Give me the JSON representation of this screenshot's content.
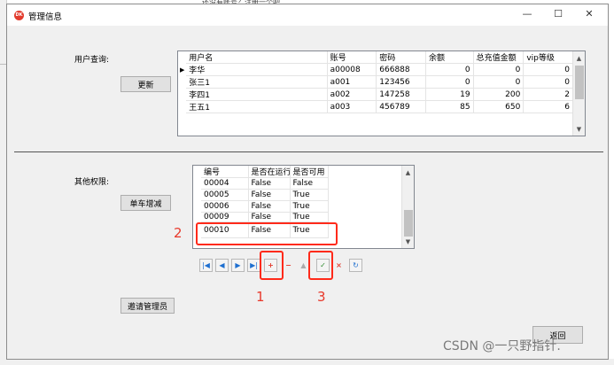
{
  "background": {
    "top_text": "还没有账号？注册一个吧"
  },
  "window": {
    "title": "管理信息",
    "icon_text": "DK",
    "minimize_glyph": "—",
    "maximize_glyph": "☐",
    "close_glyph": "✕"
  },
  "user_query": {
    "label": "用户查询:",
    "refresh_button": "更新",
    "columns": [
      "用户名",
      "账号",
      "密码",
      "余额",
      "总充值金额",
      "vip等级"
    ],
    "rows": [
      {
        "marker": "▶",
        "cells": [
          "李华",
          "a00008",
          "666888",
          "0",
          "0",
          "0"
        ]
      },
      {
        "marker": "",
        "cells": [
          "张三1",
          "a001",
          "123456",
          "0",
          "0",
          "0"
        ]
      },
      {
        "marker": "",
        "cells": [
          "李四1",
          "a002",
          "147258",
          "19",
          "200",
          "2"
        ]
      },
      {
        "marker": "",
        "cells": [
          "王五1",
          "a003",
          "456789",
          "85",
          "650",
          "6"
        ]
      }
    ]
  },
  "other_permissions": {
    "label": "其他权限:",
    "car_button": "单车增减",
    "columns": [
      "编号",
      "是否在运行",
      "是否可用"
    ],
    "rows": [
      {
        "marker": "",
        "cells": [
          "00004",
          "False",
          "False"
        ]
      },
      {
        "marker": "",
        "cells": [
          "00005",
          "False",
          "True"
        ]
      },
      {
        "marker": "",
        "cells": [
          "00006",
          "False",
          "True"
        ]
      },
      {
        "marker": "",
        "cells": [
          "00009",
          "False",
          "True"
        ]
      },
      {
        "marker": "I",
        "cells": [
          "00010",
          "False",
          "True"
        ]
      }
    ]
  },
  "navigator": {
    "first": "|◀",
    "prev": "◀",
    "next": "▶",
    "last": "▶|",
    "add": "+",
    "delete": "−",
    "edit": "▲",
    "post": "✓",
    "cancel": "×",
    "refresh": "↻"
  },
  "invite_button": "邀请管理员",
  "return_button": "返回",
  "annotations": {
    "n1": "1",
    "n2": "2",
    "n3": "3"
  },
  "watermark": "CSDN @一只野指针.",
  "colors": {
    "annotation_red": "#ff2a1a",
    "accent_blue": "#1e6fd0",
    "title_icon_red": "#e23c2e"
  }
}
